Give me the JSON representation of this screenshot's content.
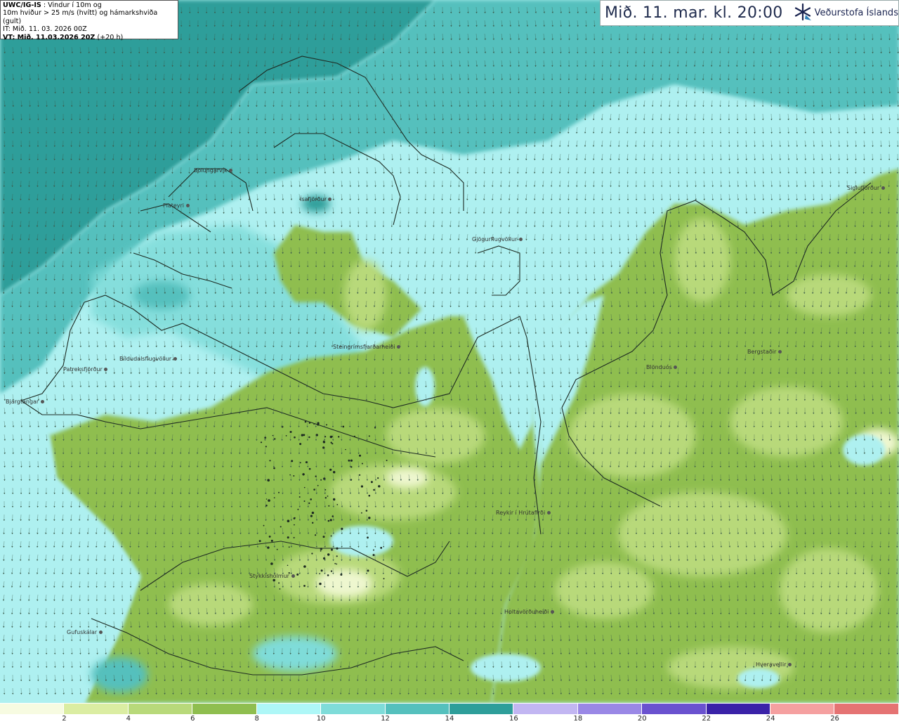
{
  "info": {
    "model": "UWC/IG-IS",
    "line1_rest": " : Vindur í 10m og",
    "line2": "10m hviður > 25 m/s (hvítt) og hámarkshviða (gult)",
    "line3": "IT: Mið. 11. 03. 2026 00Z",
    "line4_bold": "VT: Mið. 11.03.2026 20Z",
    "line4_rest": " (+20 h)"
  },
  "header": {
    "valid_time": "Mið. 11. mar. kl. 20:00",
    "logo_text": "Veðurstofa Íslands",
    "logo_icon": "snowflake-arrow-icon"
  },
  "colors": {
    "sea_deep": "#2e9e9a",
    "sea_mid": "#53c3c2",
    "sea_light": "#aef0f0",
    "land_main": "#8fbe4f",
    "land_light": "#b8d97a",
    "land_pale": "#dbeeb0",
    "coast": "#1d2a22",
    "arrow": "#3b5a4a"
  },
  "legend": {
    "unit": "m/s",
    "bins": [
      {
        "from": 0,
        "to": 2,
        "color": "#f7fbe1"
      },
      {
        "from": 2,
        "to": 4,
        "color": "#dbeda2"
      },
      {
        "from": 4,
        "to": 6,
        "color": "#b8d97a"
      },
      {
        "from": 6,
        "to": 8,
        "color": "#8fbe4f"
      },
      {
        "from": 8,
        "to": 10,
        "color": "#aef7f7"
      },
      {
        "from": 10,
        "to": 12,
        "color": "#7fdcd9"
      },
      {
        "from": 12,
        "to": 14,
        "color": "#55c0bd"
      },
      {
        "from": 14,
        "to": 16,
        "color": "#2e9e9a"
      },
      {
        "from": 16,
        "to": 18,
        "color": "#c2b6f2"
      },
      {
        "from": 18,
        "to": 20,
        "color": "#9a88e6"
      },
      {
        "from": 20,
        "to": 22,
        "color": "#6a52cf"
      },
      {
        "from": 22,
        "to": 24,
        "color": "#3a22a8"
      },
      {
        "from": 24,
        "to": 26,
        "color": "#f5a0a0"
      },
      {
        "from": 26,
        "to": 28,
        "color": "#e57373"
      }
    ],
    "tick_labels": [
      "2",
      "4",
      "6",
      "8",
      "10",
      "12",
      "14",
      "16",
      "18",
      "20",
      "22",
      "24",
      "26"
    ]
  },
  "places": [
    {
      "name": "Bolungarvík"
    },
    {
      "name": "Flateyri"
    },
    {
      "name": "Ísafjörður"
    },
    {
      "name": "Gjögurflugvöllur"
    },
    {
      "name": "Siglufjörður"
    },
    {
      "name": "Patreksfjörður"
    },
    {
      "name": "Bíldudalsflugvöllur"
    },
    {
      "name": "Bjargtangar"
    },
    {
      "name": "Steingrímsfjarðarheiði"
    },
    {
      "name": "Blönduós"
    },
    {
      "name": "Bergstaðir"
    },
    {
      "name": "Reykir í Hrútafirði"
    },
    {
      "name": "Stykkishólmur"
    },
    {
      "name": "Holtavörðuheiði"
    },
    {
      "name": "Gufuskálar"
    },
    {
      "name": "Hveravellir"
    }
  ]
}
